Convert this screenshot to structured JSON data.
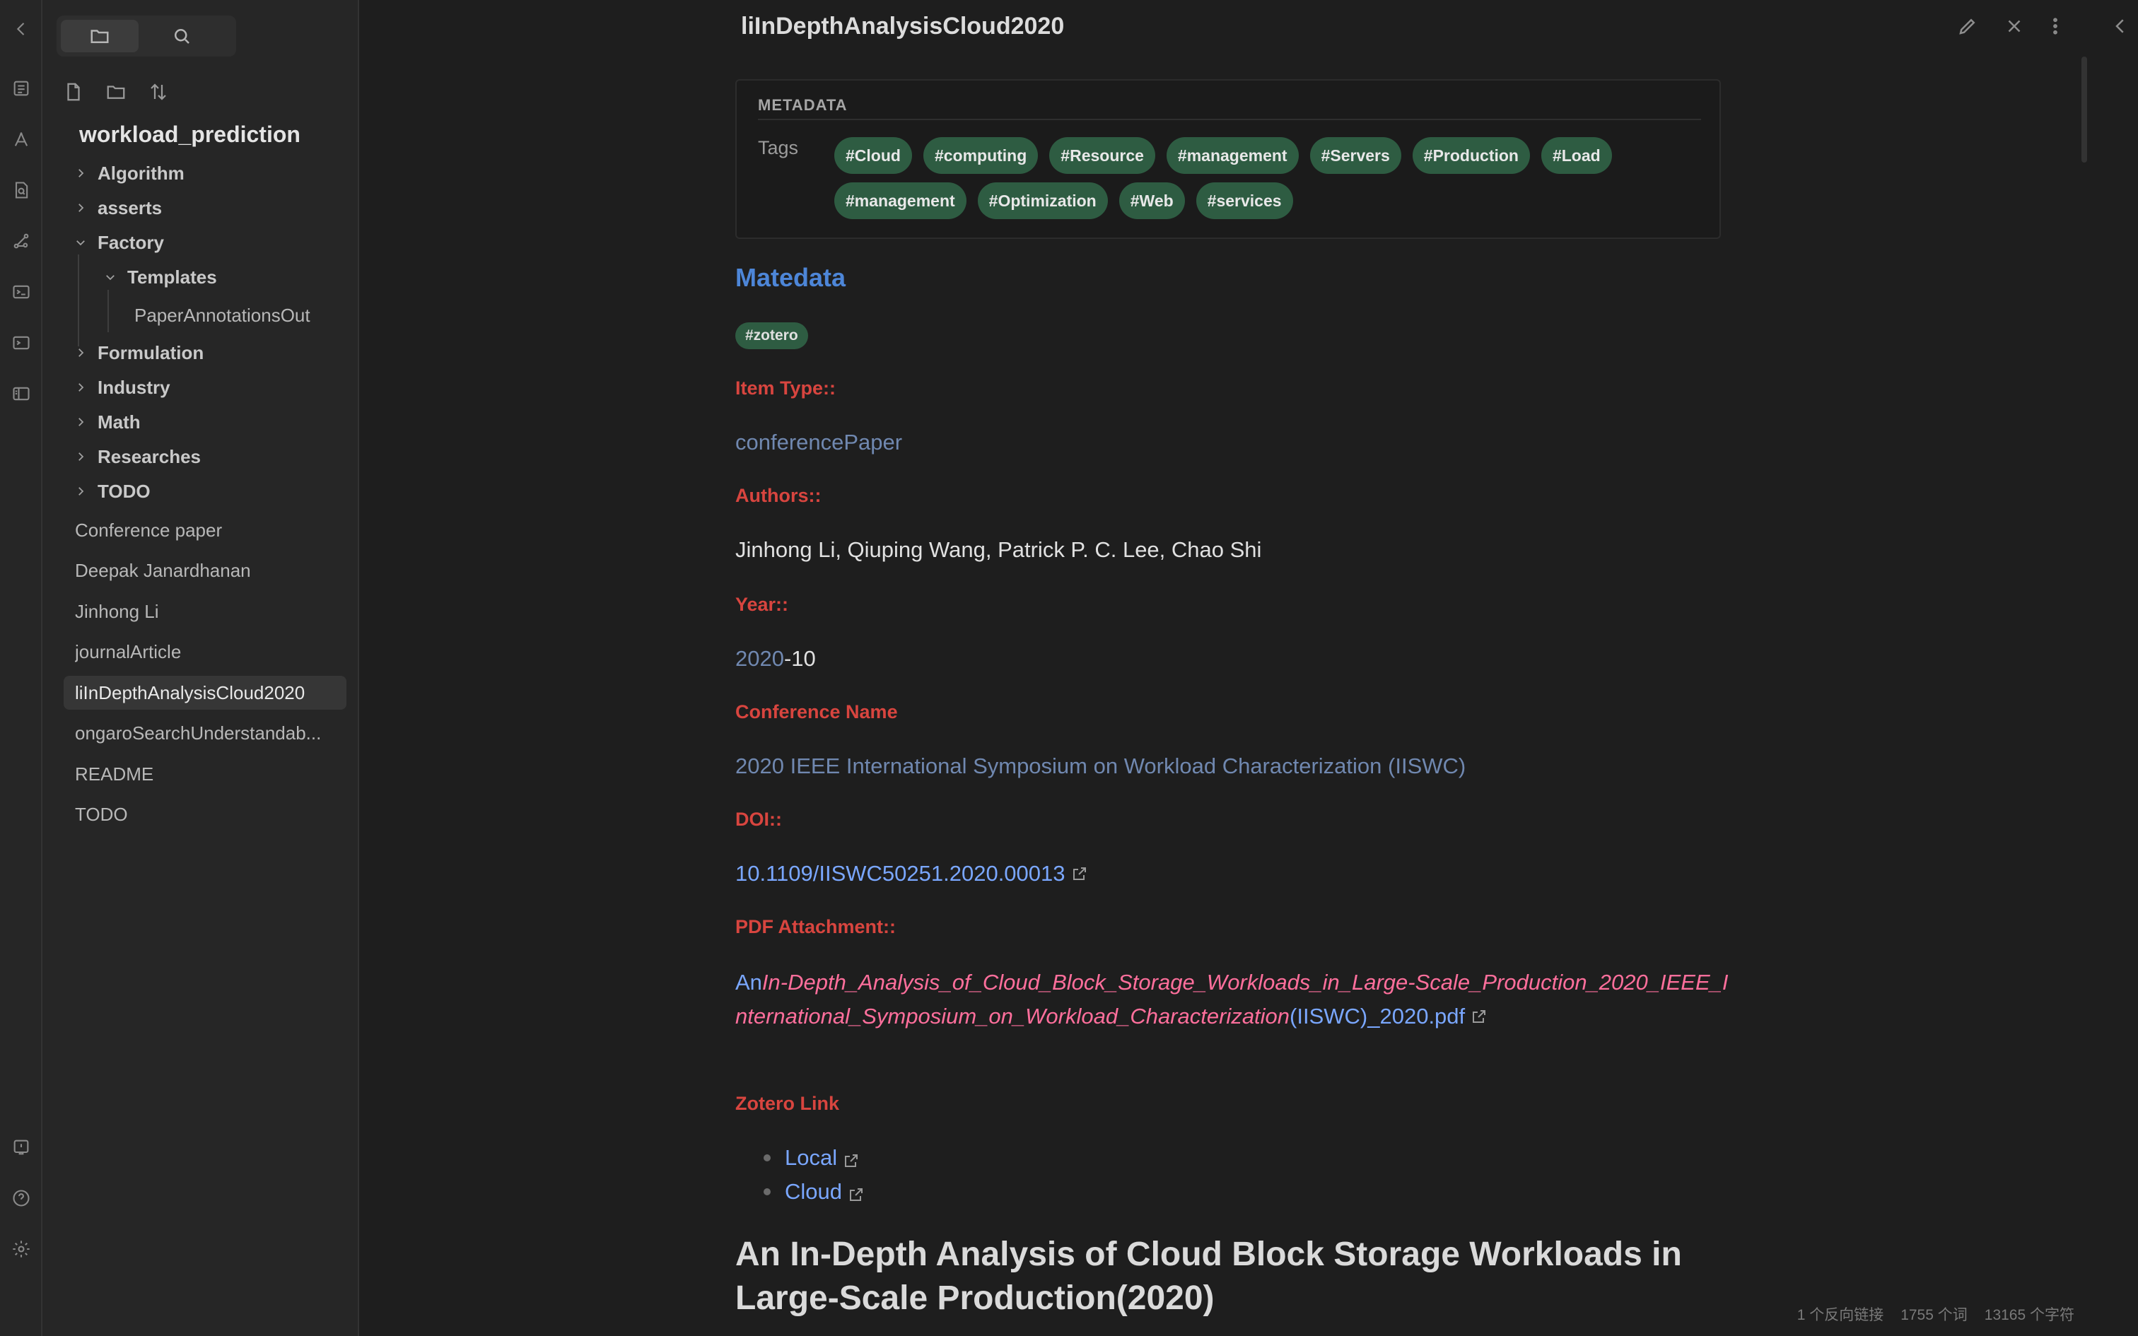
{
  "ribbon": {
    "icons": [
      "collapse-left-icon",
      "pages-icon",
      "pdf-tool-icon",
      "search-file-icon",
      "graph-icon",
      "terminal-icon",
      "terminal-alt-icon",
      "layout-icon",
      "vault-switch-icon",
      "help-icon",
      "settings-icon"
    ]
  },
  "explorer": {
    "vault_name": "workload_prediction",
    "folders": [
      {
        "label": "Algorithm",
        "expanded": false
      },
      {
        "label": "asserts",
        "expanded": false
      },
      {
        "label": "Factory",
        "expanded": true
      },
      {
        "label": "Templates",
        "expanded": true
      },
      {
        "label": "Formulation",
        "expanded": false
      },
      {
        "label": "Industry",
        "expanded": false
      },
      {
        "label": "Math",
        "expanded": false
      },
      {
        "label": "Researches",
        "expanded": false
      },
      {
        "label": "TODO",
        "expanded": false
      }
    ],
    "nested_file": "PaperAnnotationsOut",
    "files": [
      "Conference paper",
      "Deepak Janardhanan",
      "Jinhong Li",
      "journalArticle",
      "liInDepthAnalysisCloud2020",
      "ongaroSearchUnderstandab...",
      "README",
      "TODO"
    ],
    "active_file": "liInDepthAnalysisCloud2020"
  },
  "note": {
    "title": "liInDepthAnalysisCloud2020",
    "metadata": {
      "heading": "METADATA",
      "key": "Tags",
      "tags": [
        "#Cloud",
        "#computing",
        "#Resource",
        "#management",
        "#Servers",
        "#Production",
        "#Load",
        "#management",
        "#Optimization",
        "#Web",
        "#services"
      ]
    },
    "section_heading": "Matedata",
    "zotero_tag": "#zotero",
    "item_type_label": "Item Type::",
    "item_type": "conferencePaper",
    "authors_label": "Authors::",
    "authors": "Jinhong Li, Qiuping Wang, Patrick P. C. Lee, Chao Shi",
    "year_label": "Year::",
    "year_link": "2020",
    "year_rest": "-10",
    "conference_label": "Conference Name",
    "conference": "2020 IEEE International Symposium on Workload Characterization (IISWC)",
    "doi_label": "DOI::",
    "doi": "10.1109/IISWC50251.2020.00013",
    "pdf_label": "PDF Attachment::",
    "pdf_prefix": "An",
    "pdf_italic": "In-Depth_Analysis_of_Cloud_Block_Storage_Workloads_in_Large-Scale_Production_2020_IEEE_International_Symposium_on_Workload_Characterization",
    "pdf_suffix": "(IISWC)_2020.pdf",
    "zotero_label": "Zotero Link",
    "zotero_links": [
      "Local",
      "Cloud"
    ],
    "h1": "An In-Depth Analysis of Cloud Block Storage Workloads in Large-Scale Production(2020)"
  },
  "status_bar": {
    "backlinks": "1 个反向链接",
    "words": "1755 个词",
    "chars": "13165 个字符"
  },
  "colors": {
    "tag_bg": "#2e5c42",
    "field_label": "#d8453f",
    "link": "#7aa7ff",
    "heading_blue": "#4d86d8"
  }
}
